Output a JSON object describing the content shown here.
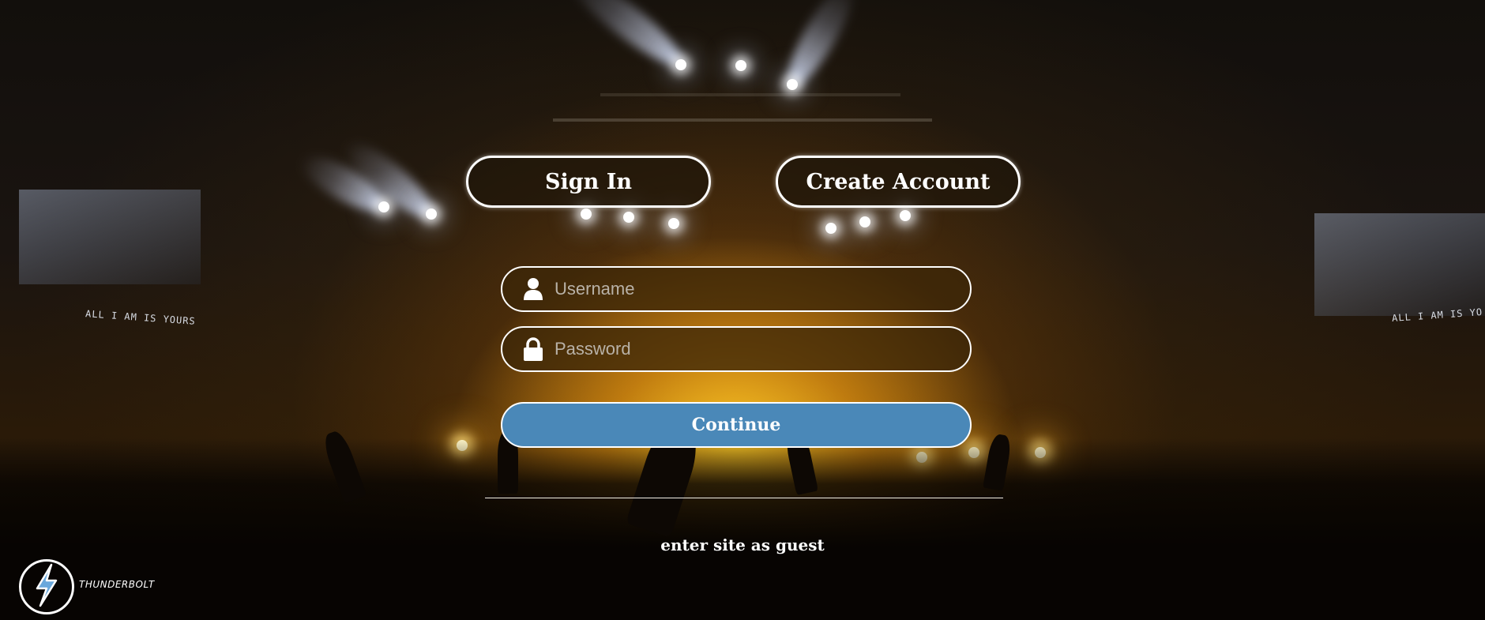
{
  "auth_tabs": {
    "sign_in_label": "Sign In",
    "create_account_label": "Create Account"
  },
  "form": {
    "username_placeholder": "Username",
    "password_placeholder": "Password",
    "username_icon": "user-icon",
    "password_icon": "lock-icon",
    "continue_label": "Continue"
  },
  "guest_link": "enter site as guest",
  "brand": {
    "name": "THUNDERBOLT",
    "icon": "lightning-bolt-icon"
  },
  "background": {
    "screen_caption_left": "ALL I AM IS YOURS",
    "screen_caption_right": "ALL I AM IS YO"
  },
  "colors": {
    "continue_button": "#4a88b8",
    "outline": "#ffffff",
    "stage_glow": "#ffc828"
  }
}
